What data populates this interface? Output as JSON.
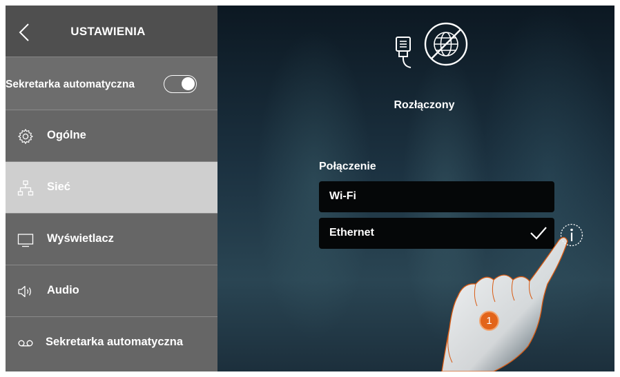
{
  "sidebar": {
    "title": "USTAWIENIA",
    "toggle": {
      "label": "Sekretarka automatyczna",
      "state": "on"
    },
    "items": [
      {
        "label": "Ogólne",
        "icon": "gear-icon"
      },
      {
        "label": "Sieć",
        "icon": "network-icon",
        "active": true
      },
      {
        "label": "Wyświetlacz",
        "icon": "monitor-icon"
      },
      {
        "label": "Audio",
        "icon": "speaker-icon"
      },
      {
        "label": "Sekretarka automatyczna",
        "icon": "voicemail-icon"
      }
    ]
  },
  "main": {
    "status": "Rozłączony",
    "section_label": "Połączenie",
    "options": [
      {
        "label": "Wi-Fi",
        "selected": false
      },
      {
        "label": "Ethernet",
        "selected": true
      }
    ],
    "step_badge": "1"
  },
  "colors": {
    "sidebar_header": "#4f4f4f",
    "sidebar_bg": "#666666",
    "active_item": "#cfcfcf",
    "option_bg": "#050708",
    "badge": "#e2641a"
  }
}
